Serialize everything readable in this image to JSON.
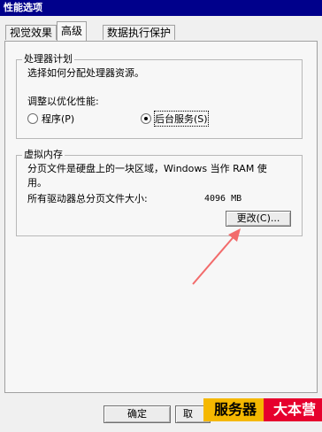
{
  "window": {
    "title": "性能选项"
  },
  "tabs": [
    {
      "label": "视觉效果"
    },
    {
      "label": "高级"
    },
    {
      "label": "数据执行保护"
    }
  ],
  "processor": {
    "group_title": "处理器计划",
    "description": "选择如何分配处理器资源。",
    "adjust_label": "调整以优化性能:",
    "option_programs": "程序(P)",
    "option_services": "后台服务(S)",
    "selected": "后台服务(S)"
  },
  "virtual_memory": {
    "group_title": "虚拟内存",
    "description": "分页文件是硬盘上的一块区域，Windows 当作 RAM 使用。",
    "desc_line1": "分页文件是硬盘上的一块区域，Windows 当作 RAM 使",
    "desc_line2": "用。",
    "total_label": "所有驱动器总分页文件大小:",
    "total_value": "4096 MB",
    "change_button": "更改(C)..."
  },
  "footer": {
    "ok_button": "确定",
    "cancel_partial": "取"
  },
  "watermark": {
    "left": "服务器",
    "right": "大本营"
  },
  "colors": {
    "titlebar": "#00008b",
    "arrow": "#f26b6b",
    "badge_left": "#f5b800",
    "badge_right": "#e6002d"
  }
}
